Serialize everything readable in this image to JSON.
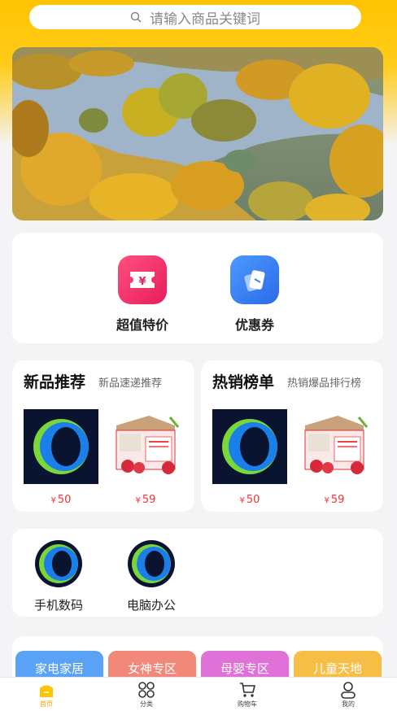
{
  "search": {
    "placeholder": "请输入商品关键词"
  },
  "banner": {
    "alt": ""
  },
  "promos": [
    {
      "label": "超值特价",
      "icon": "ticket-yen-icon",
      "color": "#f2306b"
    },
    {
      "label": "优惠券",
      "icon": "coupon-icon",
      "color": "#2f7bf0"
    }
  ],
  "features": [
    {
      "title": "新品推荐",
      "subtitle": "新品速递推荐",
      "products": [
        {
          "price": "50",
          "image": "ring-logo"
        },
        {
          "price": "59",
          "image": "apple-box"
        }
      ]
    },
    {
      "title": "热销榜单",
      "subtitle": "热销爆品排行榜",
      "products": [
        {
          "price": "50",
          "image": "ring-logo"
        },
        {
          "price": "59",
          "image": "apple-box"
        }
      ]
    }
  ],
  "categories": [
    {
      "label": "手机数码",
      "icon": "ring-logo-icon"
    },
    {
      "label": "电脑办公",
      "icon": "ring-logo-icon"
    }
  ],
  "tags": [
    {
      "label": "家电家居",
      "color": "#5aa2f5"
    },
    {
      "label": "女神专区",
      "color": "#f2887a"
    },
    {
      "label": "母婴专区",
      "color": "#e071d9"
    },
    {
      "label": "儿童天地",
      "color": "#f7be45"
    }
  ],
  "currency_symbol": "¥",
  "tabbar": {
    "items": [
      {
        "label": "首页",
        "icon": "home-icon",
        "active": true
      },
      {
        "label": "分类",
        "icon": "category-icon",
        "active": false
      },
      {
        "label": "购物车",
        "icon": "cart-icon",
        "active": false
      },
      {
        "label": "我的",
        "icon": "profile-icon",
        "active": false
      }
    ]
  },
  "colors": {
    "accent": "#ffc400",
    "price": "#ee3333"
  }
}
